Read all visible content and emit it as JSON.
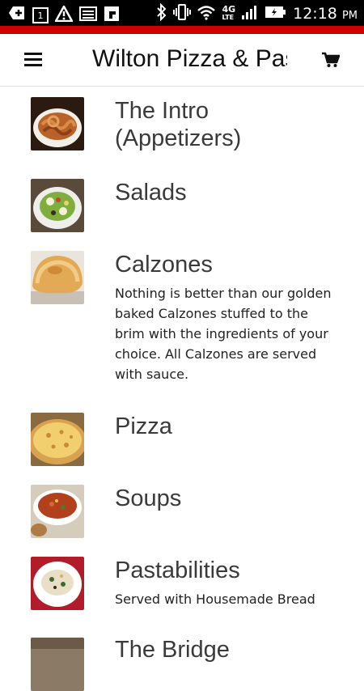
{
  "status_bar": {
    "notification_count": "1",
    "network_label": "4G",
    "network_sub": "LTE",
    "time": "12:18",
    "ampm": "PM"
  },
  "app_bar": {
    "title": "Wilton Pizza & Pasta"
  },
  "menu": [
    {
      "name": "The Intro (Appetizers)",
      "description": ""
    },
    {
      "name": "Salads",
      "description": ""
    },
    {
      "name": "Calzones",
      "description": "Nothing is better than our golden baked Calzones stuffed to the brim with the ingredients of your choice. All Calzones are served with sauce."
    },
    {
      "name": "Pizza",
      "description": ""
    },
    {
      "name": "Soups",
      "description": ""
    },
    {
      "name": "Pastabilities",
      "description": "Served with Housemade Bread"
    },
    {
      "name": "The Bridge",
      "description": ""
    }
  ]
}
